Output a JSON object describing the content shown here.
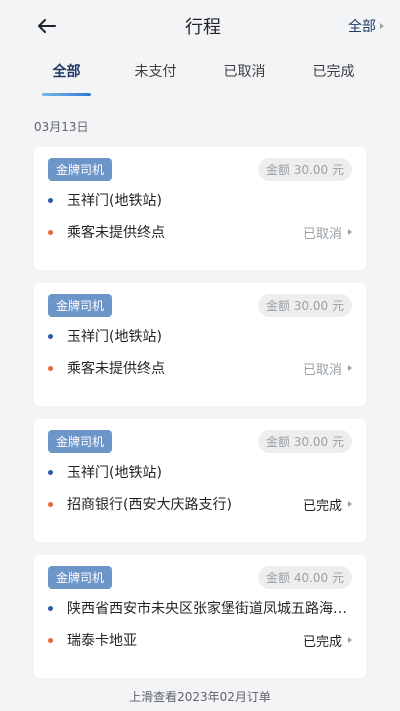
{
  "header": {
    "title": "行程",
    "filter_label": "全部"
  },
  "tabs": [
    {
      "label": "全部",
      "active": true
    },
    {
      "label": "未支付",
      "active": false
    },
    {
      "label": "已取消",
      "active": false
    },
    {
      "label": "已完成",
      "active": false
    }
  ],
  "date_label": "03月13日",
  "trips": [
    {
      "badge": "金牌司机",
      "amount": "金额 30.00 元",
      "start": "玉祥门(地铁站)",
      "end": "乘客未提供终点",
      "status": "已取消"
    },
    {
      "badge": "金牌司机",
      "amount": "金额 30.00 元",
      "start": "玉祥门(地铁站)",
      "end": "乘客未提供终点",
      "status": "已取消"
    },
    {
      "badge": "金牌司机",
      "amount": "金额 30.00 元",
      "start": "玉祥门(地铁站)",
      "end": "招商银行(西安大庆路支行)",
      "status": "已完成"
    },
    {
      "badge": "金牌司机",
      "amount": "金额 40.00 元",
      "start": "陕西省西安市未央区张家堡街道凤城五路海璟...",
      "end": "瑞泰卡地亚",
      "status": "已完成"
    }
  ],
  "footer": "上滑查看2023年02月订单",
  "colors": {
    "accent": "#1f3a66",
    "badge": "#6d95c8",
    "start_dot": "#2a5ba8",
    "end_dot": "#e06a3a"
  }
}
